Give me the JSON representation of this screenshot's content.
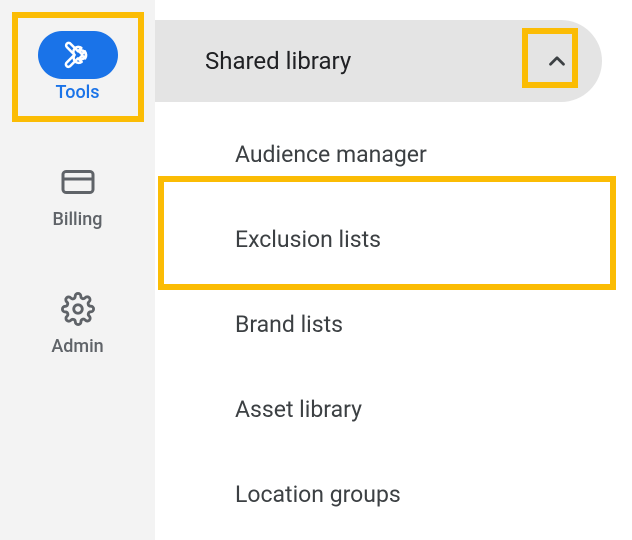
{
  "sidebar": {
    "tools_label": "Tools",
    "billing_label": "Billing",
    "admin_label": "Admin"
  },
  "panel": {
    "header": "Shared library",
    "items": [
      "Audience manager",
      "Exclusion lists",
      "Brand lists",
      "Asset library",
      "Location groups"
    ]
  }
}
